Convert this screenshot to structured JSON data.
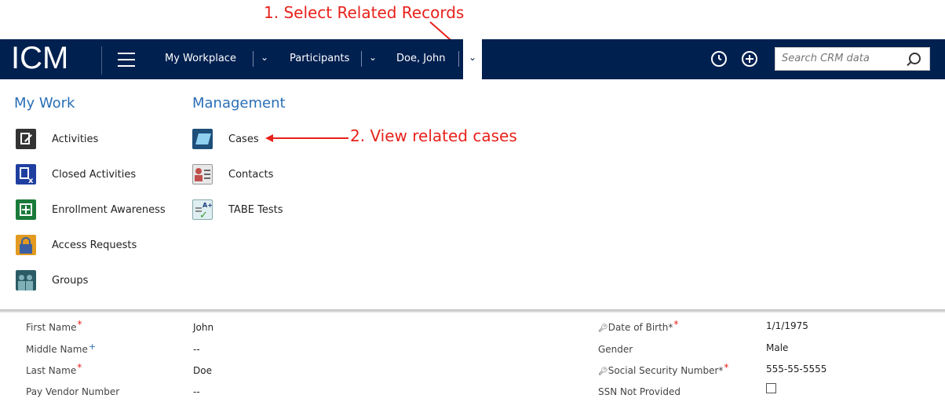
{
  "annotations": {
    "step1": "1. Select Related Records",
    "step2": "2. View related cases",
    "color": "#e8211b"
  },
  "nav": {
    "brand": "ICM",
    "breadcrumbs": [
      {
        "label": "My Workplace"
      },
      {
        "label": "Participants"
      },
      {
        "label": "Doe, John"
      }
    ],
    "icons": [
      "hamburger-menu-icon",
      "recent-clock-icon",
      "create-plus-icon",
      "search-icon"
    ],
    "search_placeholder": "Search CRM data",
    "background": "#002050"
  },
  "menu": {
    "my_work": {
      "title": "My Work",
      "items": [
        {
          "label": "Activities",
          "icon": "activities-icon"
        },
        {
          "label": "Closed Activities",
          "icon": "closed-activities-icon"
        },
        {
          "label": "Enrollment Awareness",
          "icon": "enrollment-awareness-icon"
        },
        {
          "label": "Access Requests",
          "icon": "access-requests-icon"
        },
        {
          "label": "Groups",
          "icon": "groups-icon"
        }
      ]
    },
    "management": {
      "title": "Management",
      "items": [
        {
          "label": "Cases",
          "icon": "cases-icon"
        },
        {
          "label": "Contacts",
          "icon": "contacts-icon"
        },
        {
          "label": "TABE Tests",
          "icon": "tabe-tests-icon"
        }
      ]
    },
    "accent": "#2a6fb6"
  },
  "form": {
    "left": [
      {
        "label": "First Name",
        "value": "John"
      },
      {
        "label": "Middle Name",
        "value": "--"
      },
      {
        "label": "Last Name",
        "value": "Doe"
      },
      {
        "label": "Pay Vendor Number",
        "value": "--"
      }
    ],
    "right": [
      {
        "label": "Date of Birth*",
        "value": "1/1/1975"
      },
      {
        "label": "Gender",
        "value": "Male"
      },
      {
        "label": "Social Security Number*",
        "value": "555-55-5555"
      },
      {
        "label": "SSN Not Provided",
        "value": ""
      }
    ],
    "required_mark": "*",
    "recommended_mark": "+"
  }
}
